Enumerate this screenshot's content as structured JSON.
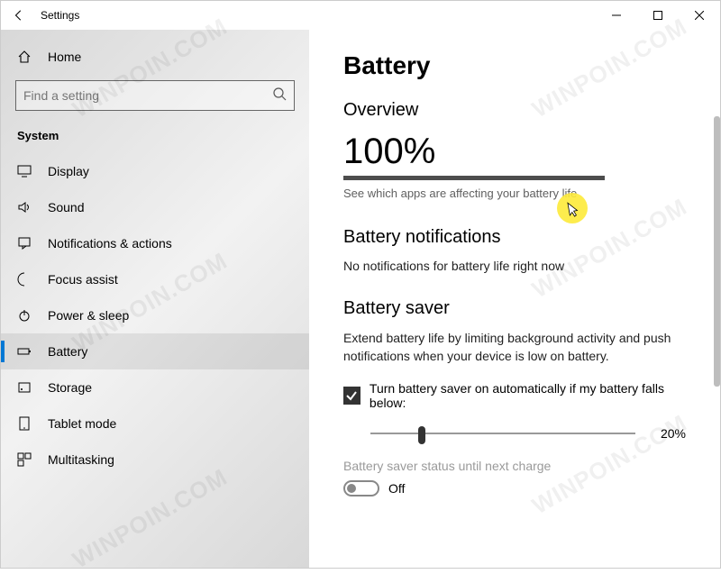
{
  "window": {
    "title": "Settings"
  },
  "sidebar": {
    "home": "Home",
    "search_placeholder": "Find a setting",
    "section": "System",
    "items": [
      {
        "label": "Display"
      },
      {
        "label": "Sound"
      },
      {
        "label": "Notifications & actions"
      },
      {
        "label": "Focus assist"
      },
      {
        "label": "Power & sleep"
      },
      {
        "label": "Battery"
      },
      {
        "label": "Storage"
      },
      {
        "label": "Tablet mode"
      },
      {
        "label": "Multitasking"
      }
    ]
  },
  "main": {
    "title": "Battery",
    "overview_heading": "Overview",
    "battery_percent": "100%",
    "apps_link": "See which apps are affecting your battery life",
    "notif_heading": "Battery notifications",
    "notif_text": "No notifications for battery life right now",
    "saver_heading": "Battery saver",
    "saver_desc": "Extend battery life by limiting background activity and push notifications when your device is low on battery.",
    "saver_checkbox": "Turn battery saver on automatically if my battery falls below:",
    "saver_threshold": "20%",
    "saver_status_label": "Battery saver status until next charge",
    "saver_toggle_state": "Off"
  },
  "watermark": "WINPOIN.COM"
}
